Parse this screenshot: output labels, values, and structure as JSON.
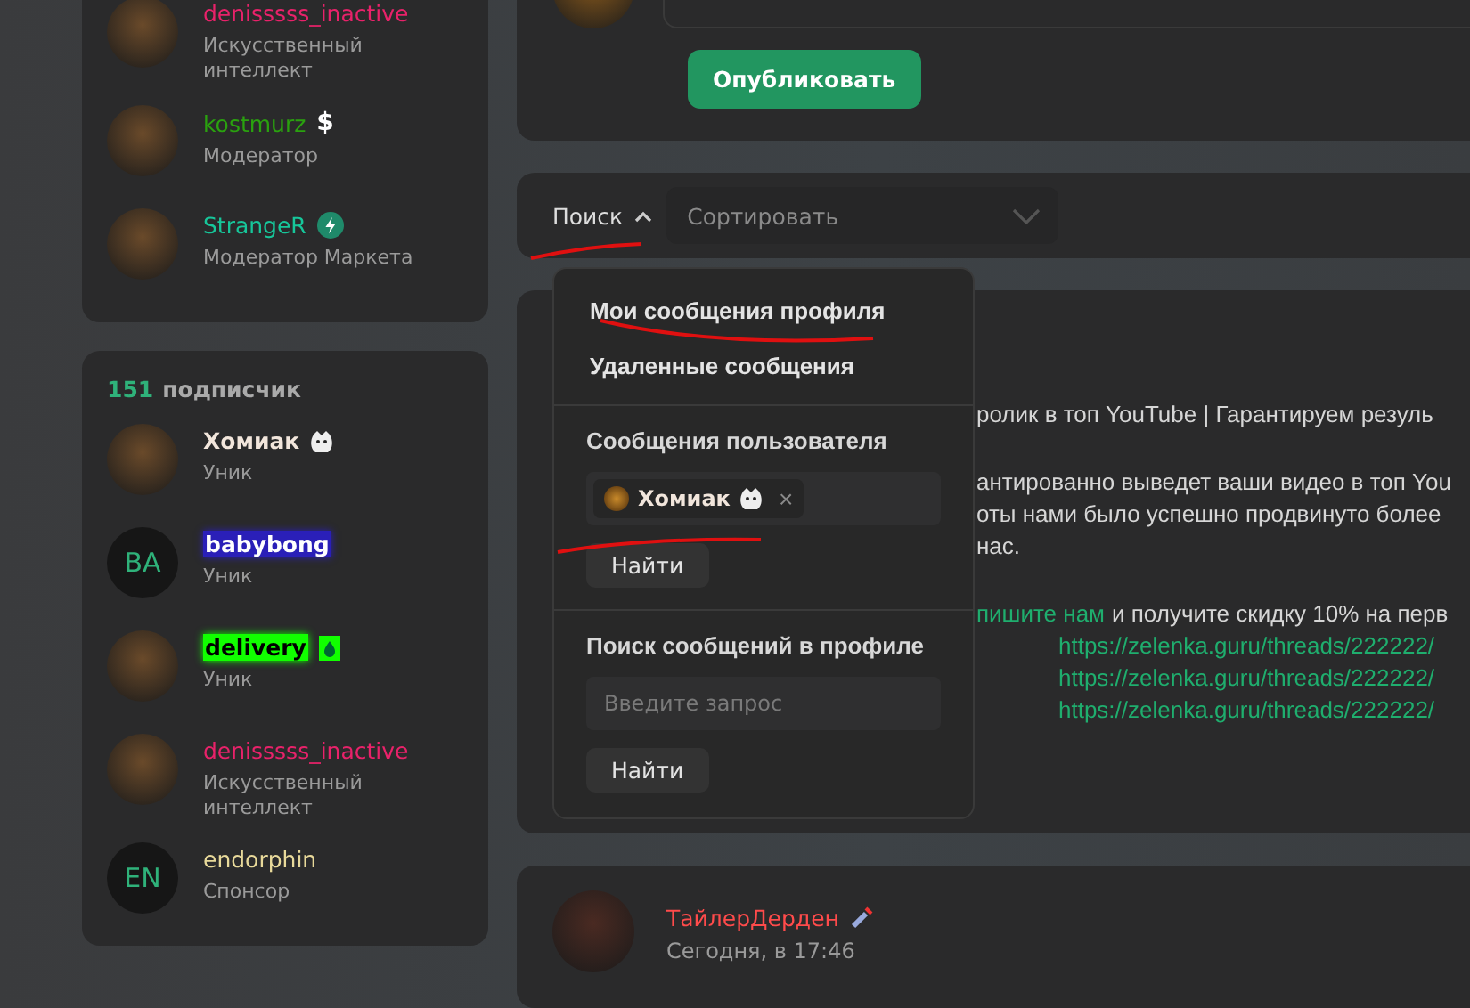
{
  "staff": [
    {
      "name": "denisssss_inactive",
      "role": "Искусственный интеллект",
      "color": "#e8226a",
      "kind": "plain",
      "avatar": {
        "kind": "photo"
      }
    },
    {
      "name": "kostmurz",
      "role": "Модератор",
      "color": "#2aa10f",
      "kind": "plain",
      "avatar": {
        "kind": "photo"
      },
      "badge": {
        "kind": "text",
        "text": "$"
      }
    },
    {
      "name": "StrangeR",
      "role": "Модератор Маркета",
      "color": "#17c69a",
      "kind": "plain",
      "avatar": {
        "kind": "photo"
      },
      "badge": {
        "kind": "bolt"
      }
    }
  ],
  "followers": {
    "count": "151",
    "label": "подписчик",
    "items": [
      {
        "name": "Хомиак",
        "role": "Уник",
        "color": "#f2e6dc",
        "kind": "bold",
        "avatar": {
          "kind": "photo"
        },
        "badge": {
          "kind": "hamster"
        }
      },
      {
        "name": "babybong",
        "role": "Уник",
        "color": "#2a1fb8",
        "kind": "highlight",
        "avatar": {
          "kind": "initials",
          "text": "BA"
        }
      },
      {
        "name": "delivery",
        "role": "Уник",
        "color": "#11ff00",
        "kind": "glow",
        "avatar": {
          "kind": "photo"
        },
        "badge": {
          "kind": "drop"
        }
      },
      {
        "name": "denisssss_inactive",
        "role": "Искусственный интеллект",
        "color": "#e8226a",
        "kind": "plain",
        "avatar": {
          "kind": "photo"
        }
      },
      {
        "name": "endorphin",
        "role": "Спонсор",
        "color": "#e8d99a",
        "kind": "plain",
        "avatar": {
          "kind": "initials",
          "text": "EN"
        }
      }
    ]
  },
  "publish_button": "Опубликовать",
  "filter": {
    "search_label": "Поиск",
    "expanded": true,
    "sort_placeholder": "Сортировать"
  },
  "search_menu": {
    "items": [
      "Мои сообщения профиля",
      "Удаленные сообщения"
    ],
    "user_section": {
      "title": "Сообщения пользователя",
      "token": "Хомиак",
      "remove": "×",
      "button": "Найти"
    },
    "query_section": {
      "title": "Поиск сообщений в профиле",
      "placeholder": "Введите запрос",
      "button": "Найти"
    }
  },
  "post": {
    "lines": [
      {
        "kind": "title",
        "text": "ролик в топ YouTube | Гарантируем резуль"
      },
      {
        "kind": "gap"
      },
      {
        "kind": "text",
        "text": "антированно выведет ваши видео в топ You"
      },
      {
        "kind": "text",
        "text": "оты нами было успешно продвинуто более"
      },
      {
        "kind": "text",
        "text": "нас."
      },
      {
        "kind": "gap"
      },
      {
        "kind": "mixed",
        "link": "пишите нам",
        "text": "и получите скидку 10% на перв"
      },
      {
        "kind": "url",
        "text": "https://zelenka.guru/threads/222222/"
      },
      {
        "kind": "url",
        "text": "https://zelenka.guru/threads/222222/"
      },
      {
        "kind": "url",
        "text": "https://zelenka.guru/threads/222222/"
      }
    ]
  },
  "next_post": {
    "author": "ТайлерДерден",
    "time": "Сегодня, в 17:46"
  }
}
